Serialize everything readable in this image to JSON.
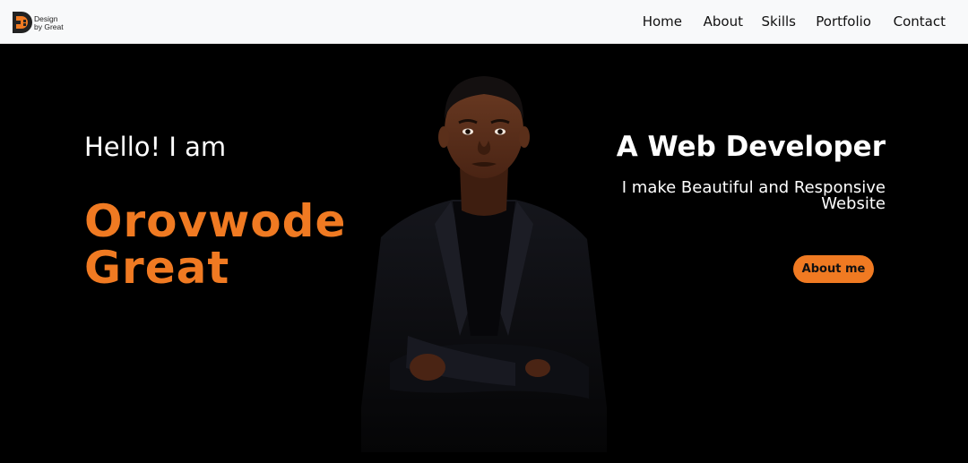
{
  "brand": {
    "line1": "Design",
    "line2": "by Great",
    "color": "#f07a22"
  },
  "nav": {
    "items": [
      {
        "label": "Home"
      },
      {
        "label": "About"
      },
      {
        "label": "Skills"
      },
      {
        "label": "Portfolio"
      },
      {
        "label": "Contact"
      }
    ]
  },
  "hero": {
    "greeting": "Hello! I am",
    "name_first": "Orovwode",
    "name_last": "Great",
    "role": "A Web Developer",
    "tagline_line1": "I make Beautiful and Responsive",
    "tagline_line2": "Website",
    "cta_label": "About me",
    "portrait_icon": "person-portrait-icon",
    "accent_color": "#f07a22",
    "background_color": "#000000"
  }
}
